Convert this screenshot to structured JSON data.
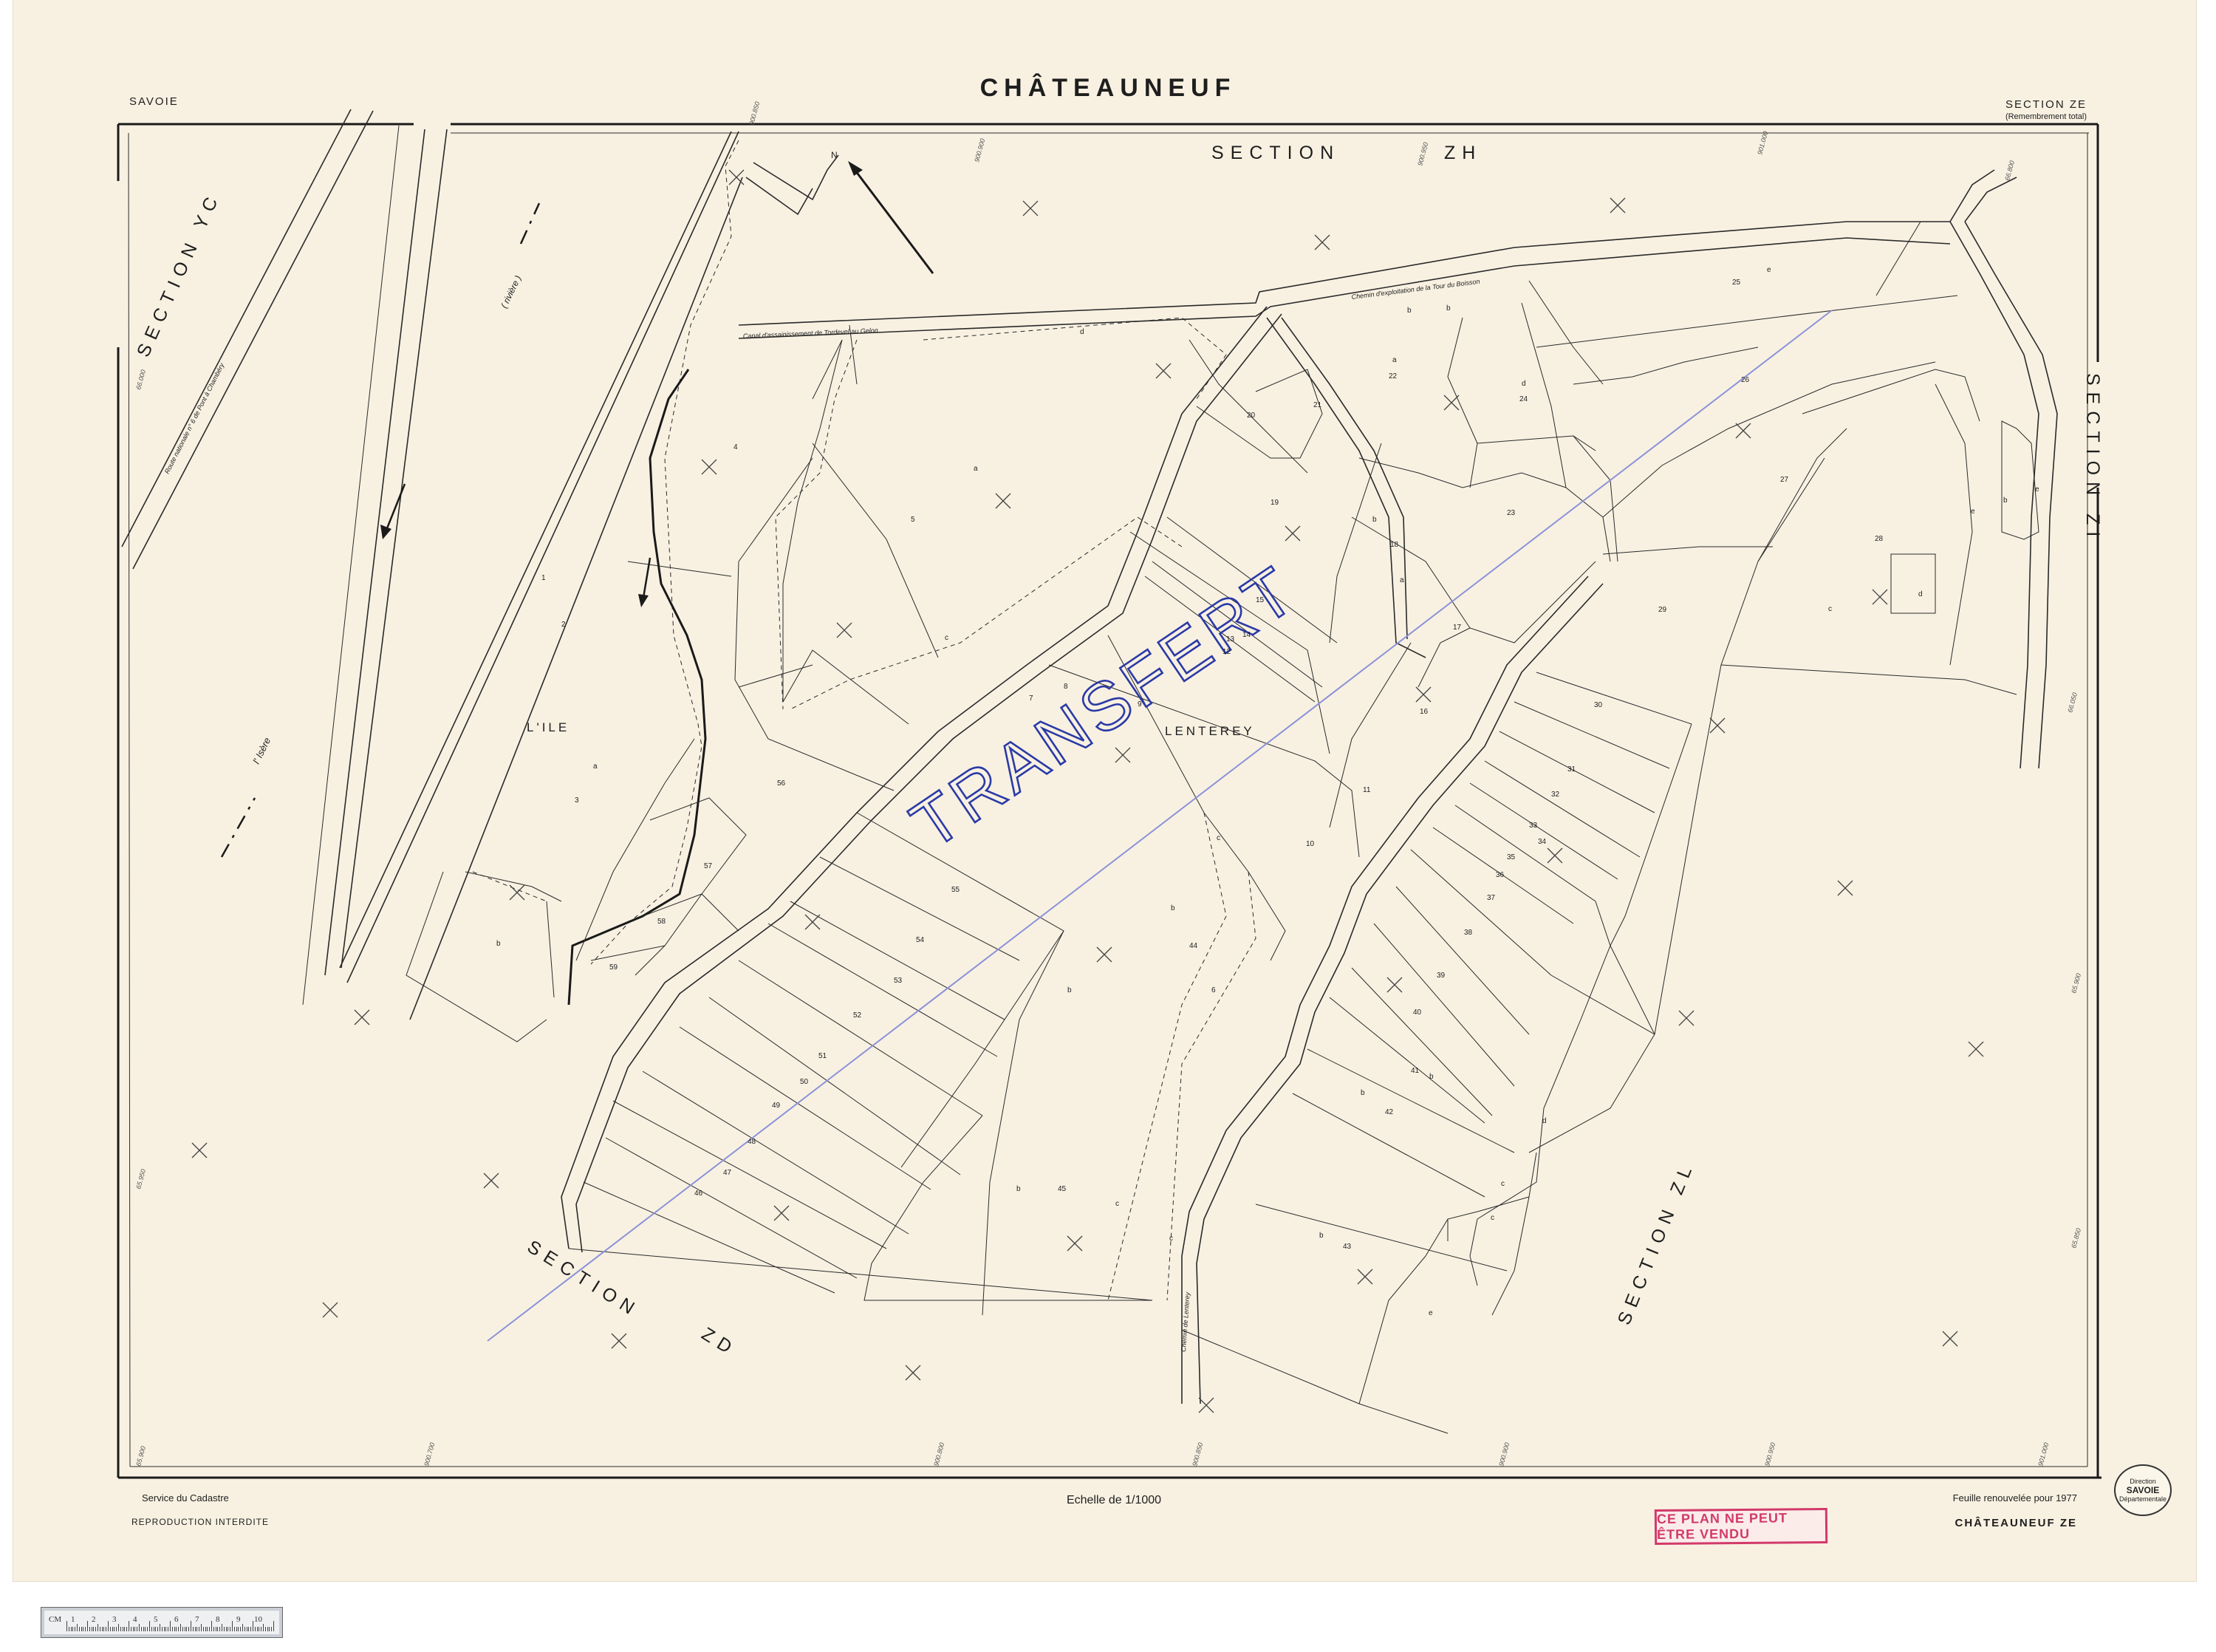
{
  "header": {
    "title": "CHÂTEAUNEUF",
    "department": "SAVOIE",
    "section": "SECTION ZE",
    "section_note": "(Remembrement total)"
  },
  "sections": {
    "north": "SECTION",
    "north_code": "ZH",
    "west": "SECTION   YC",
    "east": "SECTION   ZI",
    "southwest": "SECTION",
    "southwest_code": "ZD",
    "southeast": "SECTION   ZL"
  },
  "places": {
    "ile": "L'ILE",
    "lenterey": "LENTEREY",
    "isere": "l' Isère",
    "riviere": "( rivière )",
    "route": "Route nationale n° 6 de Pont à Chambéry",
    "canal": "Canal d'assainissement de Tordevel au Gelon",
    "chemin_nord": "Chemin d'exploitation de la Tour du Boisson",
    "chemin_lenterey": "Chemin de Lenterey"
  },
  "handwriting": "TRANSFERT",
  "footer": {
    "service": "Service du Cadastre",
    "reproduction": "REPRODUCTION INTERDITE",
    "scale": "Echelle de 1/1000",
    "renewed": "Feuille renouvelée pour 1977",
    "sheet_id": "CHÂTEAUNEUF ZE",
    "stamp": "CE PLAN NE PEUT ÊTRE VENDU",
    "seal_top": "Direction",
    "seal_mid": "SAVOIE",
    "seal_bottom": "Départementale"
  },
  "coords": {
    "top": [
      "900.850",
      "900.900",
      "900.950",
      "901.000"
    ],
    "bottom": [
      "900.700",
      "900.800",
      "900.850",
      "900.900",
      "900.950",
      "901.000",
      "901.050"
    ],
    "right": [
      "66.800",
      "66.050",
      "65.900",
      "65.850"
    ],
    "left": [
      "66.000",
      "65.950",
      "65.900"
    ]
  },
  "lots": [
    "1",
    "2",
    "3",
    "4",
    "5",
    "6",
    "7",
    "8",
    "9",
    "10",
    "11",
    "12",
    "13",
    "14",
    "15",
    "16",
    "17",
    "18",
    "19",
    "20",
    "21",
    "22",
    "23",
    "24",
    "25",
    "26",
    "27",
    "28",
    "29",
    "30",
    "31",
    "32",
    "33",
    "34",
    "35",
    "36",
    "37",
    "38",
    "39",
    "40",
    "41",
    "42",
    "43",
    "44",
    "45",
    "46",
    "47",
    "48",
    "49",
    "50",
    "51",
    "52",
    "53",
    "54",
    "55",
    "56",
    "57",
    "58",
    "59"
  ],
  "letters": [
    "a",
    "b",
    "c",
    "d",
    "e"
  ],
  "ruler": {
    "label": "CM",
    "numbers": [
      "1",
      "2",
      "3",
      "4",
      "5",
      "6",
      "7",
      "8",
      "9",
      "10"
    ]
  }
}
